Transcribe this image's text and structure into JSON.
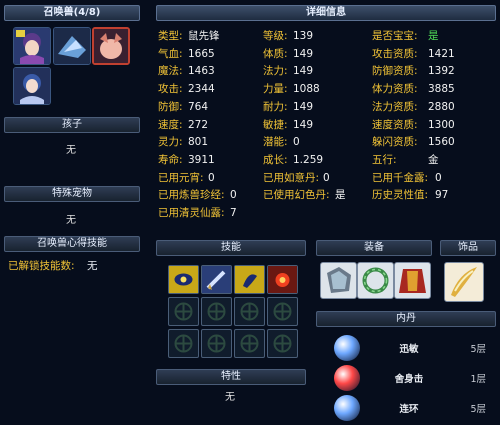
{
  "left": {
    "summon_title": "召唤兽(4/8)",
    "child_title": "孩子",
    "child_value": "无",
    "special_title": "特殊宠物",
    "special_value": "无",
    "skill_title": "召唤兽心得技能",
    "unlocked_label": "已解锁技能数:",
    "unlocked_value": "无"
  },
  "detail_title": "详细信息",
  "stats": {
    "col1": [
      {
        "k": "类型:",
        "v": "鼠先锋"
      },
      {
        "k": "气血:",
        "v": "1665"
      },
      {
        "k": "魔法:",
        "v": "1463"
      },
      {
        "k": "攻击:",
        "v": "2344"
      },
      {
        "k": "防御:",
        "v": "764"
      },
      {
        "k": "速度:",
        "v": "272"
      },
      {
        "k": "灵力:",
        "v": "801"
      },
      {
        "k": "寿命:",
        "v": "3911"
      }
    ],
    "col2": [
      {
        "k": "等级:",
        "v": "139"
      },
      {
        "k": "体质:",
        "v": "149"
      },
      {
        "k": "法力:",
        "v": "149"
      },
      {
        "k": "力量:",
        "v": "1088"
      },
      {
        "k": "耐力:",
        "v": "149"
      },
      {
        "k": "敏捷:",
        "v": "149"
      },
      {
        "k": "潜能:",
        "v": "0"
      },
      {
        "k": "成长:",
        "v": "1.259"
      }
    ],
    "col3": [
      {
        "k": "是否宝宝:",
        "v": "是"
      },
      {
        "k": "攻击资质:",
        "v": "1421"
      },
      {
        "k": "防御资质:",
        "v": "1392"
      },
      {
        "k": "体力资质:",
        "v": "3885"
      },
      {
        "k": "法力资质:",
        "v": "2880"
      },
      {
        "k": "速度资质:",
        "v": "1300"
      },
      {
        "k": "躲闪资质:",
        "v": "1560"
      },
      {
        "k": "五行:",
        "v": "金"
      }
    ],
    "extra": [
      {
        "k": "已用元宵:",
        "v": "0"
      },
      {
        "k": "已用如意丹:",
        "v": "0"
      },
      {
        "k": "已用千金露:",
        "v": "0"
      },
      {
        "k": "已用炼兽珍经:",
        "v": "0"
      },
      {
        "k": "已使用幻色丹:",
        "v": "是"
      },
      {
        "k": "历史灵性值:",
        "v": "97"
      },
      {
        "k": "已用清灵仙露:",
        "v": "7"
      }
    ]
  },
  "skills_title": "技能",
  "equip_title": "装备",
  "accessory_title": "饰品",
  "traits_title": "特性",
  "traits_value": "无",
  "neidan_title": "内丹",
  "neidan": [
    {
      "name": "迅敏",
      "level": "5层",
      "color": "#6ea8ff"
    },
    {
      "name": "舍身击",
      "level": "1层",
      "color": "#ff4848"
    },
    {
      "name": "连环",
      "level": "5层",
      "color": "#6ea8ff"
    }
  ]
}
